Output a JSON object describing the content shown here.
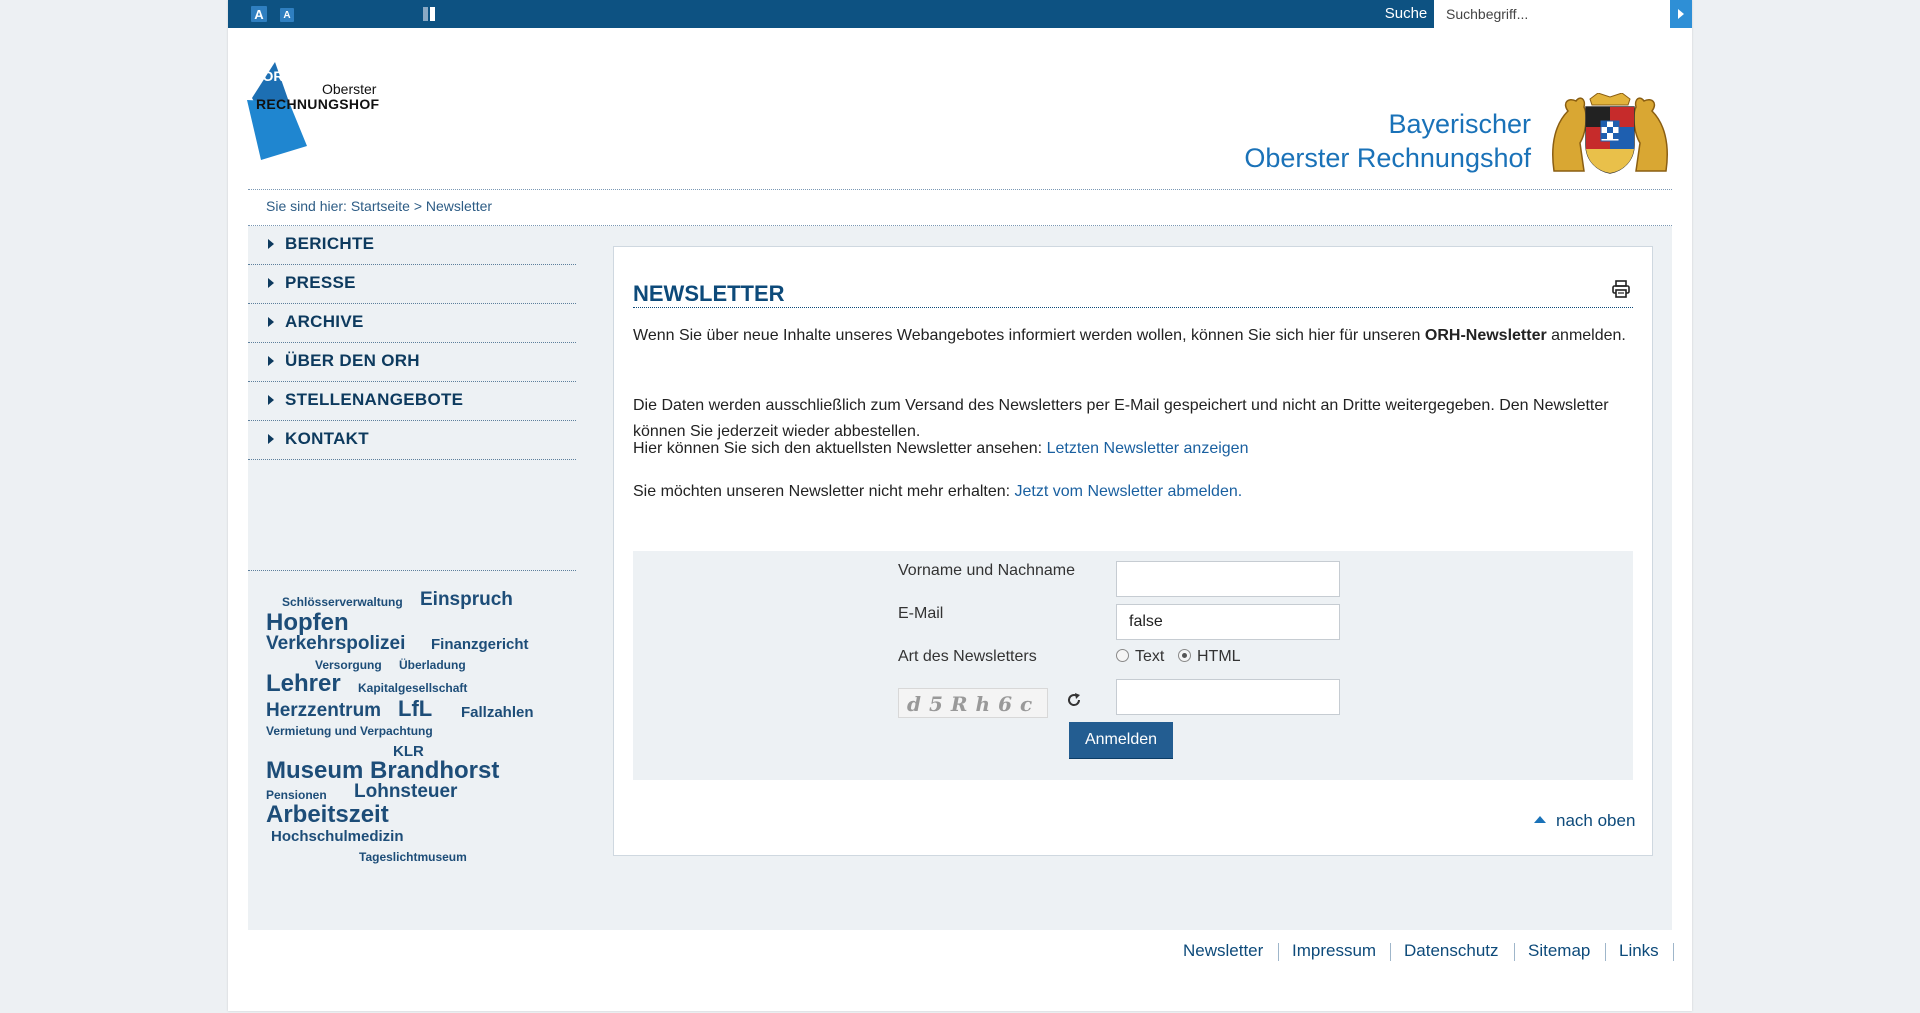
{
  "topbar": {
    "font_size_large": "A",
    "font_size_small": "A",
    "search_label": "Suche",
    "search_placeholder": "Suchbegriff..."
  },
  "header": {
    "logo_orh": "ORH",
    "logo_line1": "Oberster",
    "logo_line2": "RECHNUNGSHOF",
    "brand_line1": "Bayerischer",
    "brand_line2": "Oberster Rechnungshof"
  },
  "breadcrumb": "Sie sind hier: Startseite > Newsletter",
  "nav": [
    {
      "label": "BERICHTE"
    },
    {
      "label": "PRESSE"
    },
    {
      "label": "ARCHIVE"
    },
    {
      "label": "ÜBER DEN ORH"
    },
    {
      "label": "STELLENANGEBOTE"
    },
    {
      "label": "KONTAKT"
    }
  ],
  "tags": [
    "Schlösserverwaltung",
    "Einspruch",
    "Hopfen",
    "Verkehrspolizei",
    "Finanzgericht",
    "Versorgung",
    "Überladung",
    "Lehrer",
    "Kapitalgesellschaft",
    "Herzzentrum",
    "LfL",
    "Fallzahlen",
    "Vermietung und Verpachtung",
    "KLR",
    "Museum Brandhorst",
    "Pensionen",
    "Lohnsteuer",
    "Arbeitszeit",
    "Hochschulmedizin",
    "Tageslichtmuseum"
  ],
  "content": {
    "title": "NEWSLETTER",
    "p1_start": "Wenn Sie über neue Inhalte unseres Webangebotes informiert werden wollen, können Sie sich hier für unseren ",
    "p1_bold": "ORH-Newsletter",
    "p1_end": " anmelden.",
    "p2": "Die Daten werden ausschließlich zum Versand des Newsletters per E-Mail gespeichert und nicht an Dritte weitergegeben. Den Newsletter können Sie jederzeit wieder abbestellen.",
    "p3_text": "Hier können Sie sich den aktuellsten Newsletter ansehen: ",
    "p3_link": "Letzten Newsletter anzeigen",
    "p4_text": "Sie möchten unseren Newsletter nicht mehr erhalten: ",
    "p4_link": "Jetzt vom Newsletter abmelden."
  },
  "form": {
    "name_label": "Vorname und Nachname",
    "name_value": "",
    "email_label": "E-Mail",
    "email_value": "false",
    "type_label": "Art des Newsletters",
    "option_text": "Text",
    "option_html": "HTML",
    "selected_option": "HTML",
    "captcha_text": "d5Rh6c",
    "captcha_value": "",
    "submit_label": "Anmelden"
  },
  "back_to_top": "nach oben",
  "footer": [
    "Newsletter",
    "Impressum",
    "Datenschutz",
    "Sitemap",
    "Links"
  ],
  "colors": {
    "topbar": "#0d5282",
    "accent": "#1a72b8",
    "button": "#235d91",
    "panel": "#edf1f4"
  }
}
